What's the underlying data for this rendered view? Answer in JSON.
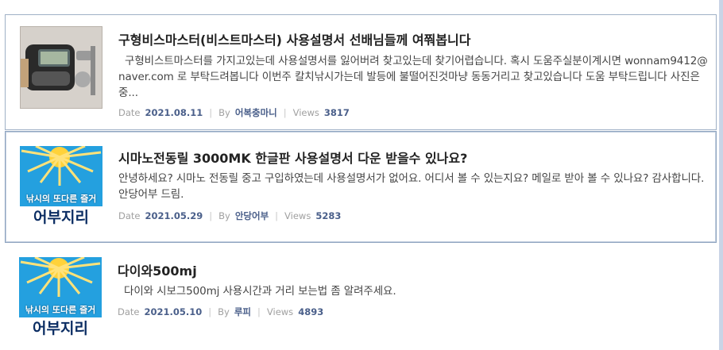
{
  "posts": [
    {
      "title": "구형비스마스터(비스트마스터) 사용설명서 선배님들께 여쭤봅니다",
      "body": "구형비스트마스터를 가지고있는데 사용설명서를   잃어버려 찾고있는데 찾기어렵습니다. 혹시 도움주실분이계시면 wonnam9412@naver.com 로 부탁드려봅니다 이번주 칼치낚시가는데 발등에 불떨어진것마냥 동동거리고 찾고있습니다 도움 부탁드립니다 사진은 중...",
      "date_label": "Date",
      "date": "2021.08.11",
      "by_label": "By",
      "author": "어복충마니",
      "views_label": "Views",
      "views": "3817",
      "thumb_icon": "fishing-reel-photo"
    },
    {
      "title": "시마노전동릴 3000MK 한글판 사용설명서 다운 받을수 있나요?",
      "body": "안녕하세요? 시마노 전동릴 중고 구입하였는데 사용설명서가 없어요. 어디서 볼 수 있는지요? 메일로 받아 볼 수 있나요? 감사합니다. 안당어부 드림.",
      "date_label": "Date",
      "date": "2021.05.29",
      "by_label": "By",
      "author": "안당어부",
      "views_label": "Views",
      "views": "5283",
      "thumb_icon": "sun-banner",
      "thumb_text1": "낚시의 또다른 즐거",
      "thumb_text2": "어부지리"
    },
    {
      "title": "다이와500mj",
      "body": "다이와 시보그500mj 사용시간과 거리 보는법 좀 알려주세요.",
      "date_label": "Date",
      "date": "2021.05.10",
      "by_label": "By",
      "author": "루피",
      "views_label": "Views",
      "views": "4893",
      "thumb_icon": "sun-banner",
      "thumb_text1": "낚시의 또다른 즐거",
      "thumb_text2": "어부지리"
    }
  ]
}
